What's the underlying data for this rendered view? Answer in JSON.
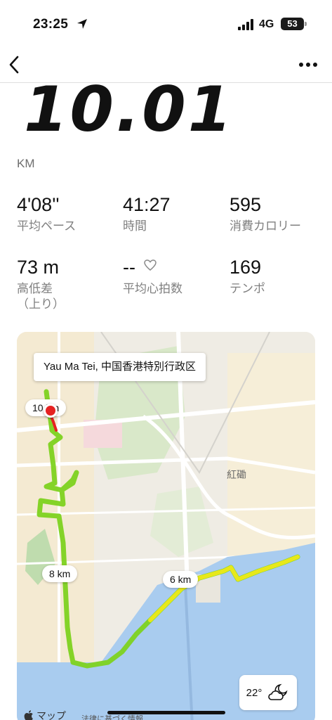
{
  "status_bar": {
    "time": "23:25",
    "network": "4G",
    "battery": "53"
  },
  "summary": {
    "distance": "10.01",
    "distance_unit": "KM"
  },
  "stats": [
    {
      "value": "4'08''",
      "label": "平均ペース"
    },
    {
      "value": "41:27",
      "label": "時間"
    },
    {
      "value": "595",
      "label": "消費カロリー"
    },
    {
      "value": "73 m",
      "label": "高低差\n（上り）"
    },
    {
      "value": "--",
      "label": "平均心拍数"
    },
    {
      "value": "169",
      "label": "テンポ"
    }
  ],
  "map": {
    "location_label": "Yau Ma Tei, 中国香港特別行政区",
    "markers": [
      "10 km",
      "8 km",
      "6 km"
    ],
    "district": "紅磡",
    "weather_temp": "22°",
    "attribution": "マップ",
    "legal": "法律に基づく情報"
  },
  "colors": {
    "route_green": "#7dd21f",
    "route_yellow": "#e8e81a",
    "water": "#a9ccef",
    "marker_red": "#e52222"
  }
}
